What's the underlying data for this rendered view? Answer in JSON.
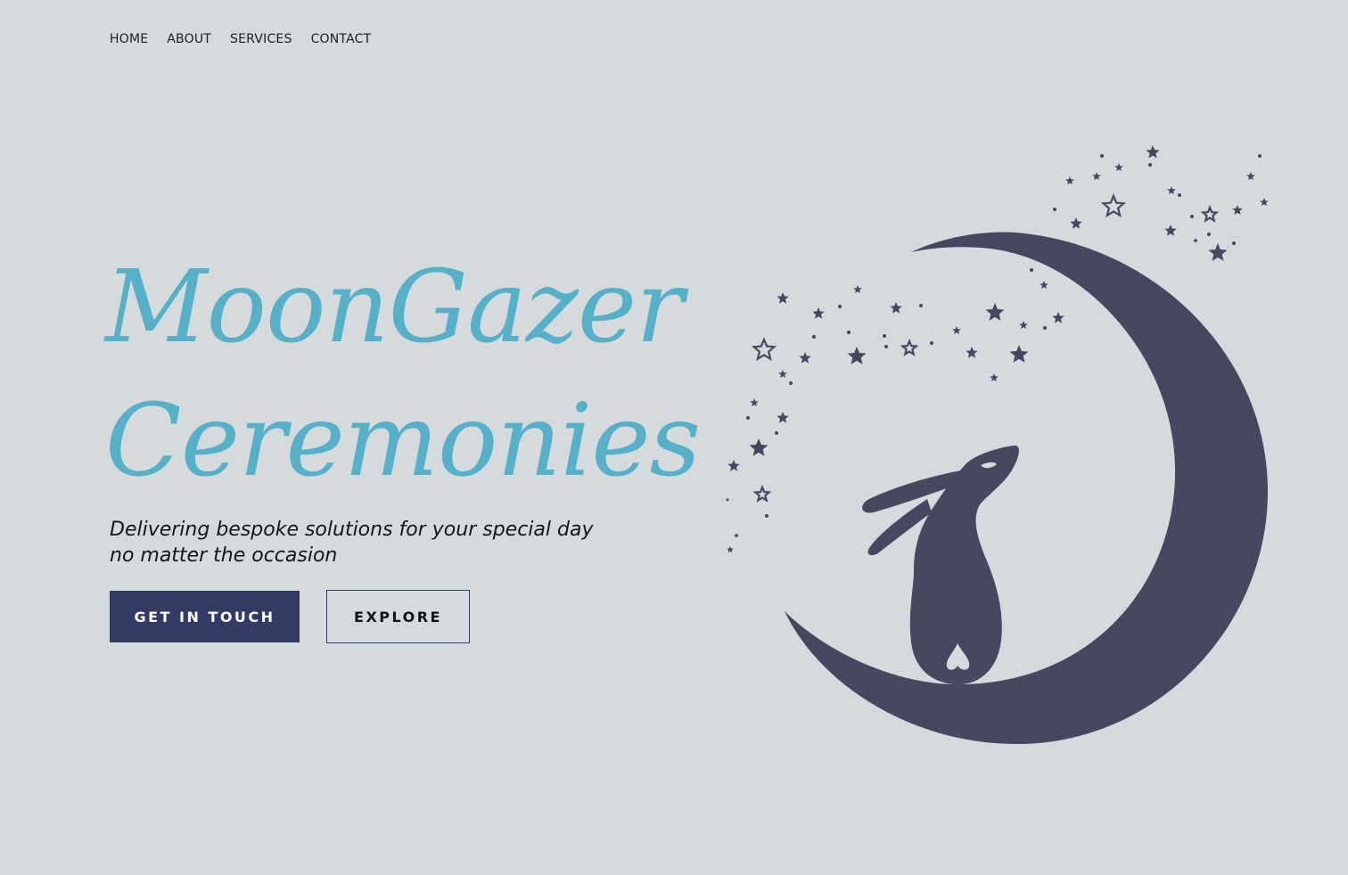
{
  "nav": {
    "items": [
      {
        "label": "HOME"
      },
      {
        "label": "ABOUT"
      },
      {
        "label": "SERVICES"
      },
      {
        "label": "CONTACT"
      }
    ]
  },
  "hero": {
    "title_line1": "MoonGazer",
    "title_line2": "Ceremonies",
    "tagline_line1": "Delivering bespoke solutions for your special day",
    "tagline_line2": "no matter the occasion",
    "primary_button": "GET IN TOUCH",
    "secondary_button": "EXPLORE"
  },
  "colors": {
    "background": "#d5dadd",
    "title": "#56b0c8",
    "primary_button": "#333b64",
    "illustration": "#474760"
  },
  "illustration": {
    "icon": "moon-gazing-hare-logo"
  }
}
